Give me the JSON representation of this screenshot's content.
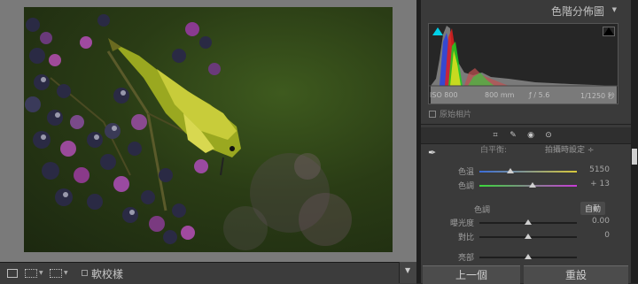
{
  "panel": {
    "title": "色階分佈圖",
    "histogram": {
      "iso": "ISO 800",
      "focal": "800 mm",
      "aperture": "ƒ / 5.6",
      "shutter": "1/1250 秒",
      "original_label": "原始相片"
    },
    "wb": {
      "label": "白平衡:",
      "value": "拍攝時設定 ÷"
    },
    "rows": [
      {
        "label": "色溫",
        "value": "5150"
      },
      {
        "label": "色調",
        "value": "+ 13"
      }
    ],
    "tone": {
      "title": "色調",
      "auto": "自動",
      "rows": [
        {
          "label": "曝光度",
          "value": "0.00"
        },
        {
          "label": "對比",
          "value": "0"
        },
        {
          "label": "亮部",
          "value": ""
        }
      ]
    },
    "buttons": {
      "prev": "上一個",
      "reset": "重設"
    }
  },
  "toolbar": {
    "soft_proof": "軟校樣"
  },
  "colors": {
    "accent_cyan": "#00d0e8",
    "temp_gradient_start": "#3a6cd8",
    "temp_gradient_end": "#d8c83a",
    "tint_gradient_start": "#3ad83a",
    "tint_gradient_end": "#c83ad8"
  },
  "icons": [
    "crop-icon",
    "spot-removal-icon",
    "red-eye-icon",
    "brush-icon",
    "eyedropper-icon",
    "loupe-view-icon",
    "compare-view-icon",
    "menu-arrow-icon"
  ]
}
